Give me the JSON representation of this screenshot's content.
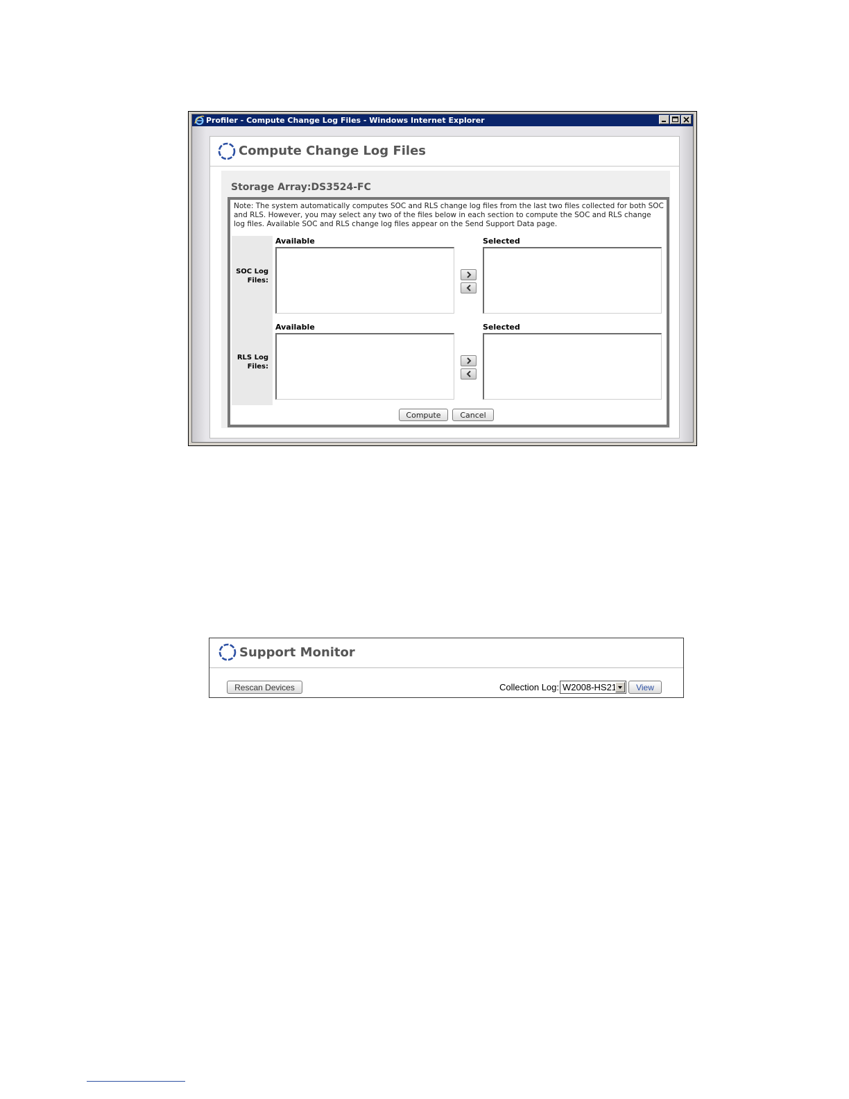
{
  "window": {
    "title": "Profiler - Compute Change Log Files - Windows Internet Explorer",
    "icon": "internet-explorer-icon",
    "controls": [
      "minimize-icon",
      "maximize-icon",
      "close-icon"
    ]
  },
  "compute_page": {
    "title": "Compute Change Log Files",
    "storage_array": "Storage Array:DS3524-FC",
    "note": "Note: The system automatically computes SOC and RLS change log files from the last two files collected for both SOC and RLS. However, you may select any two of the files below in each section to compute the SOC and RLS change log files. Available SOC and RLS change log files appear on the Send Support Data page.",
    "sections": [
      {
        "label_line1": "SOC Log",
        "label_line2": "Files:",
        "available_label": "Available",
        "selected_label": "Selected"
      },
      {
        "label_line1": "RLS Log",
        "label_line2": "Files:",
        "available_label": "Available",
        "selected_label": "Selected"
      }
    ],
    "compute_button": "Compute",
    "cancel_button": "Cancel"
  },
  "support_monitor": {
    "title": "Support Monitor",
    "rescan_button": "Rescan Devices",
    "collection_log_label": "Collection Log:",
    "collection_log_value": "W2008-HS21",
    "view_button": "View"
  },
  "colors": {
    "titlebar": "#0a246a",
    "heading_text": "#555555",
    "logo_ring": "#2b4fa3",
    "frame_border": "#777777"
  }
}
